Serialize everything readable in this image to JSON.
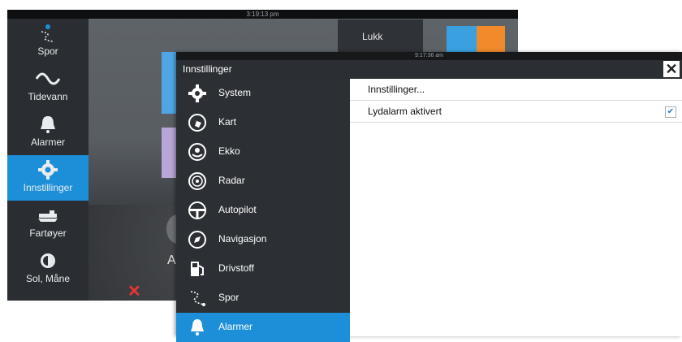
{
  "background": {
    "clock": "3:19:13 pm",
    "sidebar": [
      {
        "label": "Spor",
        "icon": "track-icon"
      },
      {
        "label": "Tidevann",
        "icon": "tide-icon"
      },
      {
        "label": "Alarmer",
        "icon": "bell-icon"
      },
      {
        "label": "Innstillinger",
        "icon": "gear-icon",
        "active": true
      },
      {
        "label": "Fartøyer",
        "icon": "vessels-icon"
      },
      {
        "label": "Sol, Måne",
        "icon": "sun-moon-icon"
      }
    ],
    "close_label": "Lukk",
    "partial_text": "Au"
  },
  "dialog": {
    "clock": "9:17:36 am",
    "title": "Innstillinger",
    "menu": [
      {
        "label": "System",
        "icon": "gear-icon"
      },
      {
        "label": "Kart",
        "icon": "chart-icon"
      },
      {
        "label": "Ekko",
        "icon": "echo-icon"
      },
      {
        "label": "Radar",
        "icon": "radar-icon"
      },
      {
        "label": "Autopilot",
        "icon": "autopilot-icon"
      },
      {
        "label": "Navigasjon",
        "icon": "compass-icon"
      },
      {
        "label": "Drivstoff",
        "icon": "fuel-icon"
      },
      {
        "label": "Spor",
        "icon": "track-icon"
      },
      {
        "label": "Alarmer",
        "icon": "bell-icon",
        "active": true
      }
    ],
    "content": {
      "settings_link": "Innstillinger...",
      "sound_alarm_label": "Lydalarm aktivert",
      "sound_alarm_enabled": true
    }
  },
  "colors": {
    "accent": "#1d8fd8",
    "panel": "#2c3034",
    "titlebar": "#2b2e32"
  }
}
